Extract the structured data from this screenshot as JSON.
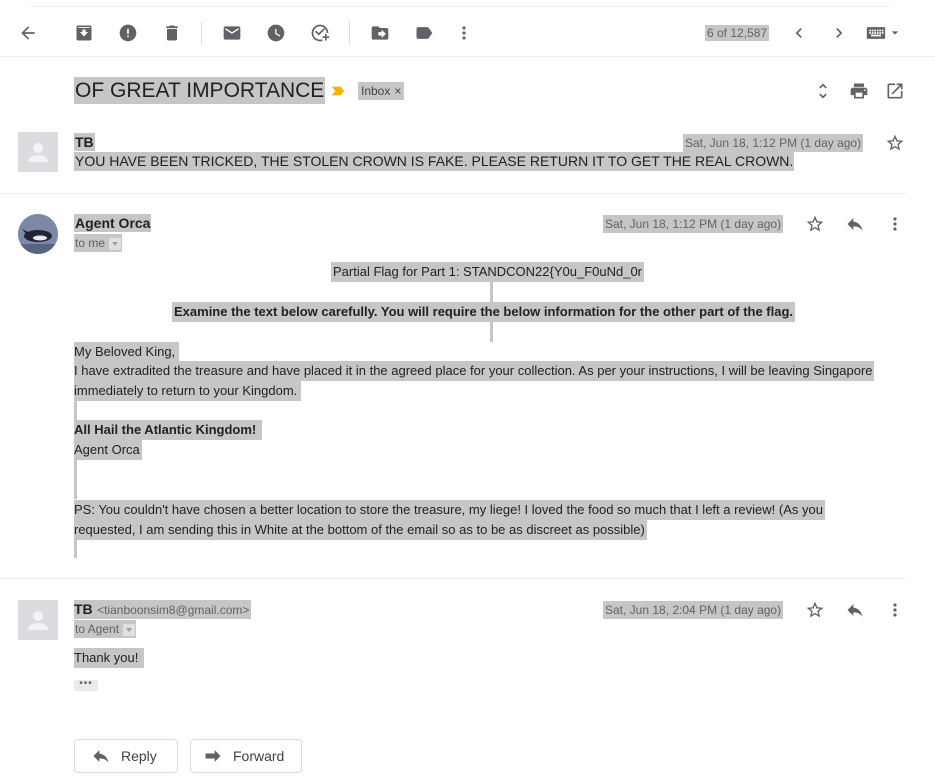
{
  "toolbar": {
    "pager": "6 of 12,587"
  },
  "thread": {
    "subject": "OF GREAT IMPORTANCE",
    "label": "Inbox",
    "label_close": "×"
  },
  "messages": [
    {
      "sender": "TB",
      "date": "Sat, Jun 18, 1:12 PM (1 day ago)",
      "snippet": "YOU HAVE BEEN TRICKED, THE STOLEN CROWN IS FAKE. PLEASE RETURN IT TO GET THE REAL CROWN."
    },
    {
      "sender": "Agent Orca",
      "date": "Sat, Jun 18, 1:12 PM (1 day ago)",
      "recipient": "to me",
      "partial_flag": "Partial Flag for Part 1: STANDCON22{Y0u_F0uNd_0r",
      "examine": "Examine the text below carefully. You will require the below information for the other part of the flag.",
      "greeting": "My Beloved King,",
      "paragraph_line1": "I have extradited the treasure and have placed it in the agreed place for your collection. As per your instructions, I will be leaving Singapore",
      "paragraph_line2": "immediately to return to your Kingdom.",
      "hail": "All Hail the Atlantic Kingdom!",
      "signoff": "Agent Orca",
      "ps_line1": "PS: You couldn't have chosen a better location to store the treasure, my liege! I loved the food so much that I left a review! (As you",
      "ps_line2": "requested, I am sending this in White at the bottom of the email so as to be as discreet as possible)"
    },
    {
      "sender": "TB",
      "email": "<tianboonsim8@gmail.com>",
      "date": "Sat, Jun 18, 2:04 PM (1 day ago)",
      "recipient": "to Agent",
      "body": "Thank you!"
    }
  ],
  "actions": {
    "reply": "Reply",
    "forward": "Forward"
  },
  "colors": {
    "highlight": "#c6c6c6",
    "label_arrow": "#f4b400",
    "icon": "#5f6368"
  }
}
